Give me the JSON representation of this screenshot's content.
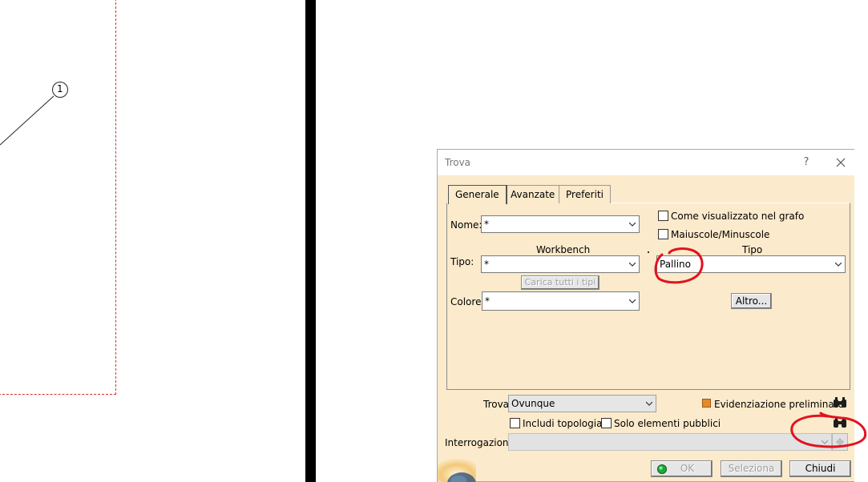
{
  "drawing": {
    "balloon_number": "1"
  },
  "dialog": {
    "title": "Trova",
    "help_label": "?",
    "tabs": [
      {
        "label": "Generale"
      },
      {
        "label": "Avanzate"
      },
      {
        "label": "Preferiti"
      }
    ],
    "nome": {
      "label": "Nome:",
      "value": "*"
    },
    "workbench_header": "Workbench",
    "tipo_header": "Tipo",
    "tipo": {
      "label": "Tipo:",
      "workbench_value": "*",
      "type_value": "Pallino"
    },
    "carica_label": "Carica tutti i tipi",
    "colore": {
      "label": "Colore:",
      "value": "*"
    },
    "come_visualizzato": {
      "label": "Come visualizzato nel grafo",
      "checked": false
    },
    "maiuscole": {
      "label": "Maiuscole/Minuscole",
      "checked": false
    },
    "altro_label": "Altro...",
    "trova": {
      "label": "Trova:",
      "value": "Ovunque"
    },
    "evidenziazione": {
      "label": "Evidenziazione preliminare",
      "checked": true
    },
    "includi_topologia": {
      "label": "Includi topologia",
      "checked": false
    },
    "solo_pubblici": {
      "label": "Solo elementi pubblici",
      "checked": false
    },
    "interrogazione_label": "Interrogazione:",
    "interrogazione_value": "",
    "ok_label": "OK",
    "seleziona_label": "Seleziona",
    "chiudi_label": "Chiudi"
  },
  "colors": {
    "dialog_bg": "#fbeacb",
    "annotation_red": "#e0131f",
    "dashed_frame": "#d0312d"
  }
}
